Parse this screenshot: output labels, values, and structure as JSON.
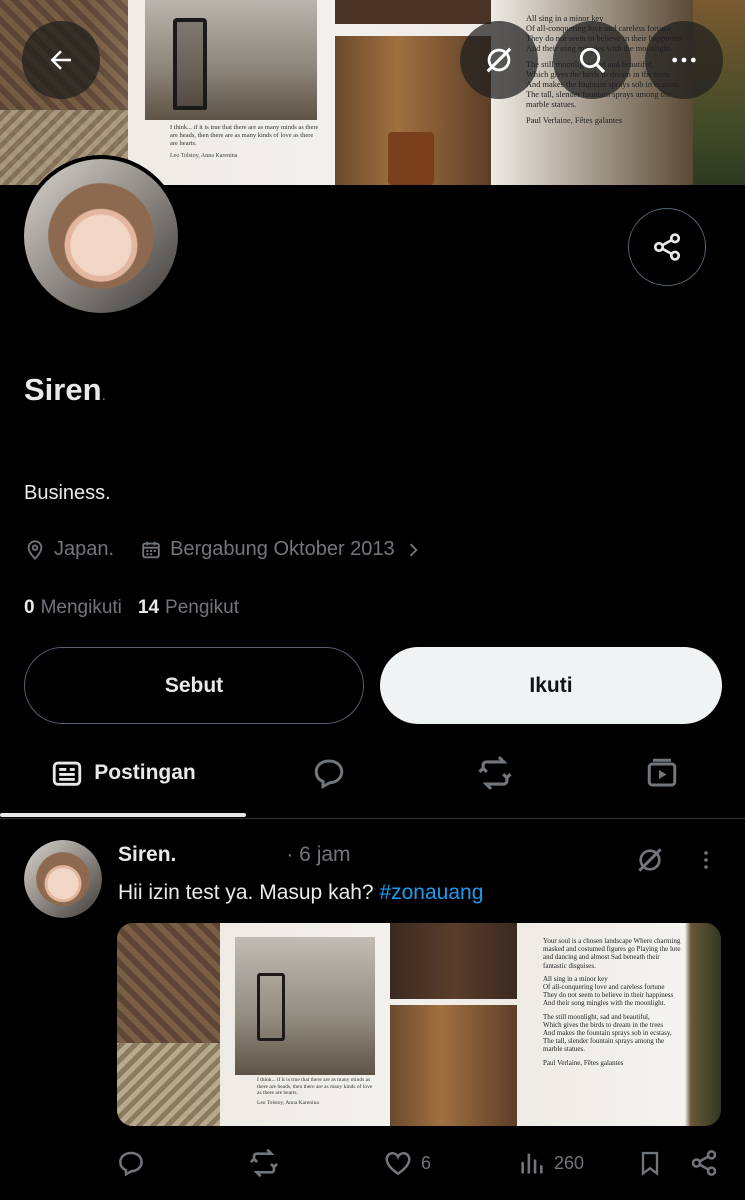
{
  "banner": {
    "poem_lines": [
      "All sing in a minor key",
      "Of all-conquering love and careless fortune",
      "They do not seem to believe in their happiness",
      "And their song mingles with the moonlight.",
      "The still moonlight, sad and beautiful,",
      "Which gives the birds to dream in the trees",
      "And makes the fountain sprays sob in ecstasy,",
      "The tall, slender fountain sprays among the marble statues."
    ],
    "poem_source": "Paul Verlaine, Fêtes galantes",
    "quote": "I think... if it is true that there are as many minds as there are heads, then there are as many kinds of love as there are hearts.",
    "quote_source": "Leo Tolstoy, Anna Karenina"
  },
  "header": {
    "back_icon": "arrow-left-icon",
    "grok_icon": "grok-icon",
    "search_icon": "search-icon",
    "more_icon": "more-horizontal-icon"
  },
  "profile": {
    "name": "Siren",
    "name_suffix": ".",
    "bio": "Business.",
    "location": "Japan.",
    "joined": "Bergabung Oktober 2013",
    "following_count": "0",
    "following_label": "Mengikuti",
    "followers_count": "14",
    "followers_label": "Pengikut"
  },
  "buttons": {
    "mention": "Sebut",
    "follow": "Ikuti"
  },
  "tabs": {
    "posts": "Postingan",
    "replies_icon": "reply-icon",
    "reposts_icon": "repost-icon",
    "media_icon": "media-icon"
  },
  "post": {
    "author": "Siren.",
    "time": "· 6 jam",
    "text": "Hii izin test ya. Masup kah? ",
    "hashtag": "#zonauang",
    "likes": "6",
    "views": "260",
    "media_poem_head": "Your soul is a chosen landscape Where charming masked and costumed figures go Playing the lute and dancing and almost Sad beneath their fantastic disguises."
  },
  "colors": {
    "background": "#000000",
    "text_primary": "#e7e9ea",
    "text_secondary": "#71767b",
    "link": "#1d9bf0",
    "border": "#536471",
    "follow_bg": "#eff3f4"
  }
}
